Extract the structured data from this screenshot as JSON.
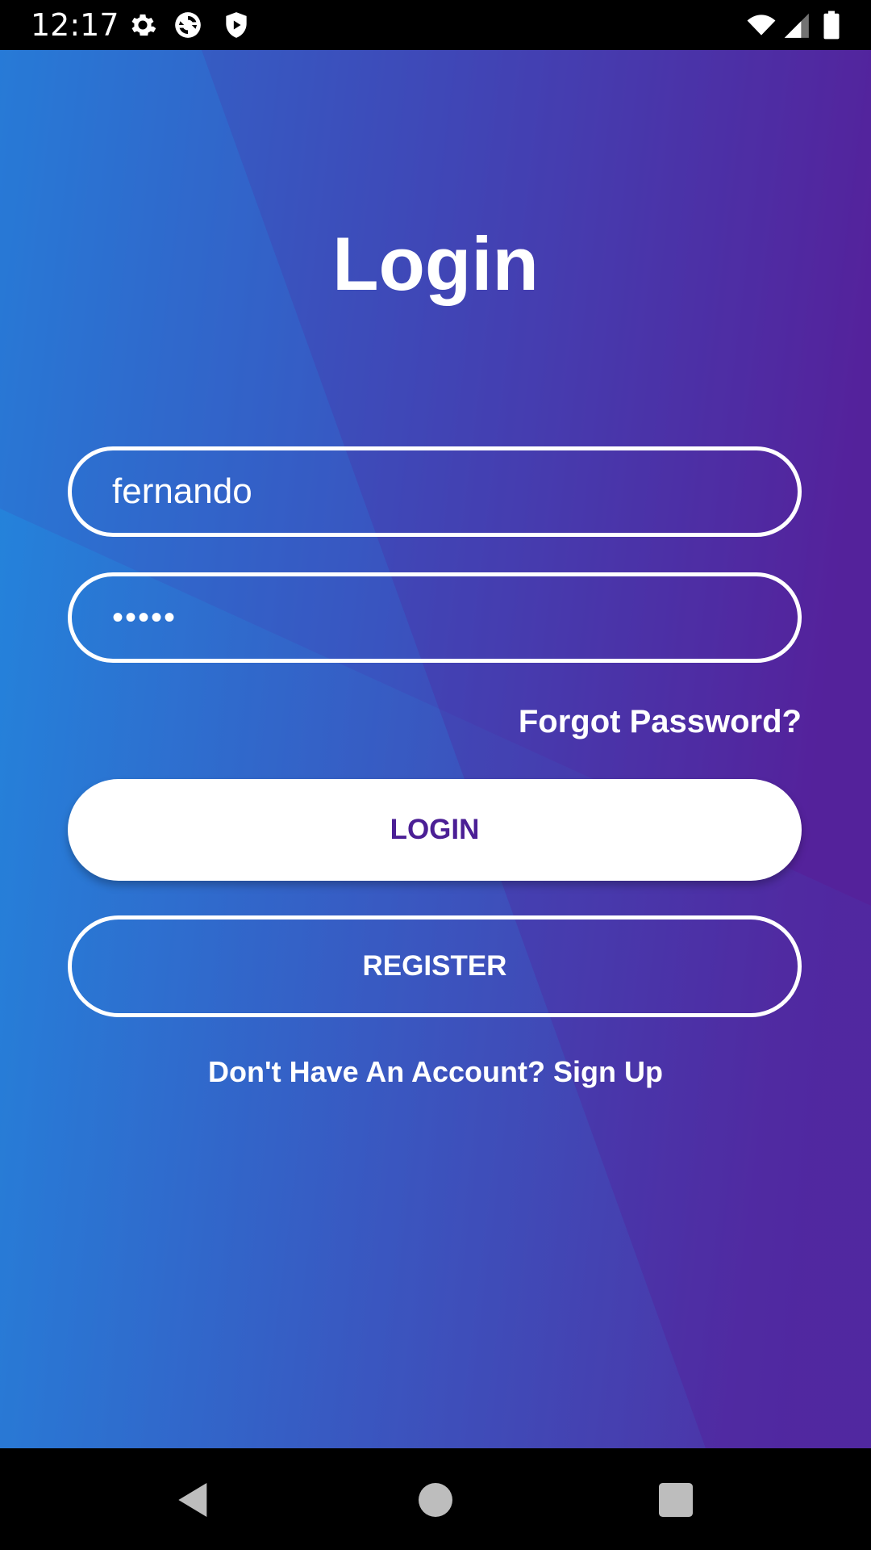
{
  "status_bar": {
    "time": "12:17",
    "left_icons": [
      "gear-icon",
      "sync-icon",
      "shield-play-icon"
    ],
    "right_icons": [
      "wifi-icon",
      "signal-icon",
      "battery-icon"
    ]
  },
  "login": {
    "title": "Login",
    "username_value": "fernando",
    "password_value": "•••••",
    "forgot_label": "Forgot Password?",
    "login_label": "LOGIN",
    "register_label": "REGISTER",
    "signup_text": "Don't Have An Account? Sign Up"
  },
  "colors": {
    "gradient_start": "#1f8fe0",
    "gradient_end": "#5a1f98",
    "login_text": "#4b1f95"
  },
  "nav_bar": {
    "buttons": [
      "back-icon",
      "home-icon",
      "recents-icon"
    ]
  }
}
